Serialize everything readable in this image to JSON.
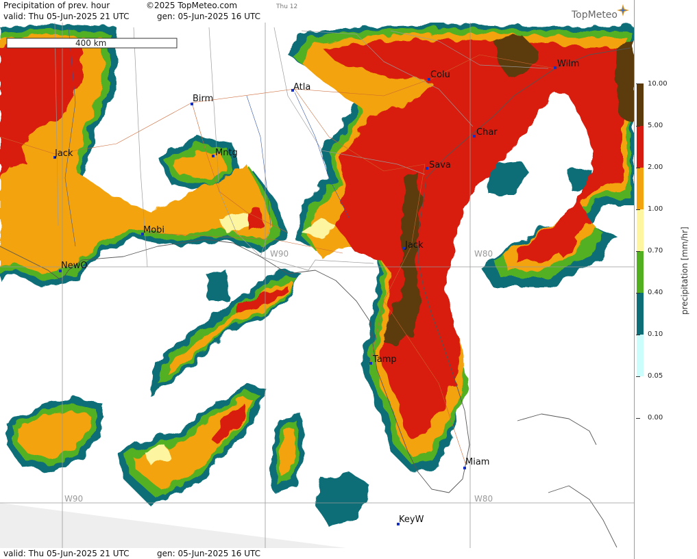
{
  "header": {
    "title": "Precipitation of prev. hour",
    "copyright": "©2025 TopMeteo.com",
    "day_tag": "Thu 12",
    "valid": "valid:  Thu  05-Jun-2025  21  UTC",
    "gen": "gen:  05-Jun-2025 16 UTC",
    "logo": "TopMeteo"
  },
  "footer": {
    "valid": "valid:  Thu  05-Jun-2025  21  UTC",
    "gen": "gen:  05-Jun-2025 16 UTC"
  },
  "map": {
    "scale_label": "400 km",
    "meridian_labels": [
      "W90",
      "W80",
      "W90",
      "W80"
    ],
    "cities": [
      "Atla",
      "Birm",
      "Mntg",
      "Jack",
      "Mobi",
      "NewO",
      "Colu",
      "Char",
      "Sava",
      "Jack",
      "Wilm",
      "Tamp",
      "Miam",
      "KeyW"
    ]
  },
  "legend": {
    "title": "precipitation  [mm/hr]",
    "levels": [
      "10.00",
      "5.00",
      "2.00",
      "1.00",
      "0.70",
      "0.40",
      "0.10",
      "0.05",
      "0.00"
    ],
    "colors": [
      "#5c3a0c",
      "#d81b10",
      "#f2a30e",
      "#fdf5a0",
      "#52b020",
      "#0e6e78",
      "#cbfdfd"
    ]
  }
}
